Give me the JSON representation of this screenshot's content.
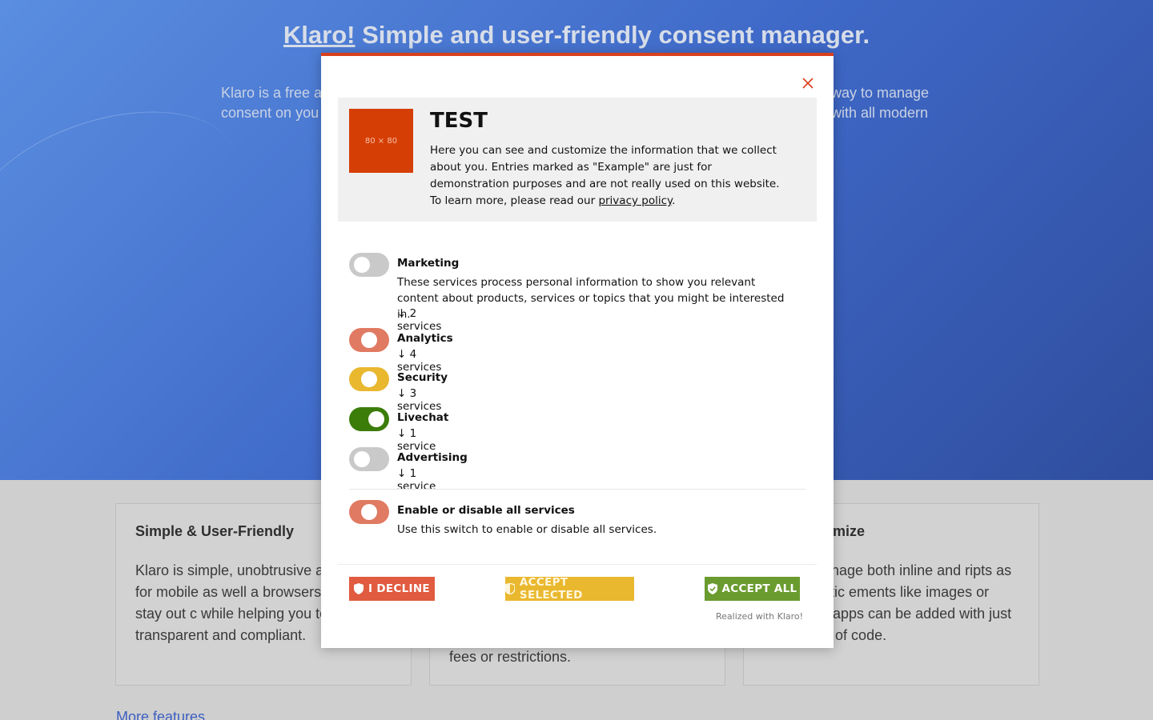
{
  "hero": {
    "title_link": "Klaro!",
    "title_rest": " Simple and user-friendly consent manager.",
    "sub_left": "Klaro is a free a consent on you",
    "sub_right": "way to manage with all modern"
  },
  "cards": [
    {
      "title": "Simple & User-Friendly",
      "text": "Klaro is simple, unobtrusive a optimized for mobile as well a browsers. It tries to stay out c while helping you to be fully transparent and compliant."
    },
    {
      "title": "",
      "text": "fees or restrictions."
    },
    {
      "title": "stomize",
      "text": "manage both inline and ripts as well as static ements like images or links. New apps can be added with just a few lines of code."
    }
  ],
  "more_features": "More features",
  "modal": {
    "logo_text": "80 × 80",
    "title": "TEST",
    "desc_before": "Here you can see and customize the information that we collect about you. Entries marked as \"Example\" are just for demonstration purposes and are not really used on this website. To learn more, please read our ",
    "desc_link": "privacy policy",
    "desc_after": ".",
    "purposes": [
      {
        "name": "Marketing",
        "desc": "These services process personal information to show you relevant content about products, services or topics that you might be interested in.",
        "count": "↓ 2 services",
        "state": "off",
        "color": "#c9c9c9"
      },
      {
        "name": "Analytics",
        "desc": "",
        "count": "↓ 4 services",
        "state": "half",
        "color": "#e07a62"
      },
      {
        "name": "Security",
        "desc": "",
        "count": "↓ 3 services",
        "state": "half",
        "color": "#e9b82f"
      },
      {
        "name": "Livechat",
        "desc": "",
        "count": "↓ 1 service",
        "state": "on",
        "color": "#3c7d0a"
      },
      {
        "name": "Advertising",
        "desc": "",
        "count": "↓ 1 service",
        "state": "off",
        "color": "#c9c9c9"
      }
    ],
    "all_toggle": {
      "name": "Enable or disable all services",
      "desc": "Use this switch to enable or disable all services.",
      "state": "half",
      "color": "#e07a62"
    },
    "buttons": {
      "decline": {
        "label": "I DECLINE",
        "color": "#e05b3f"
      },
      "accept_selected": {
        "label": "ACCEPT SELECTED",
        "color": "#e9b82f"
      },
      "accept_all": {
        "label": "ACCEPT ALL",
        "color": "#6a9b2f"
      }
    },
    "realized": "Realized with Klaro!"
  }
}
